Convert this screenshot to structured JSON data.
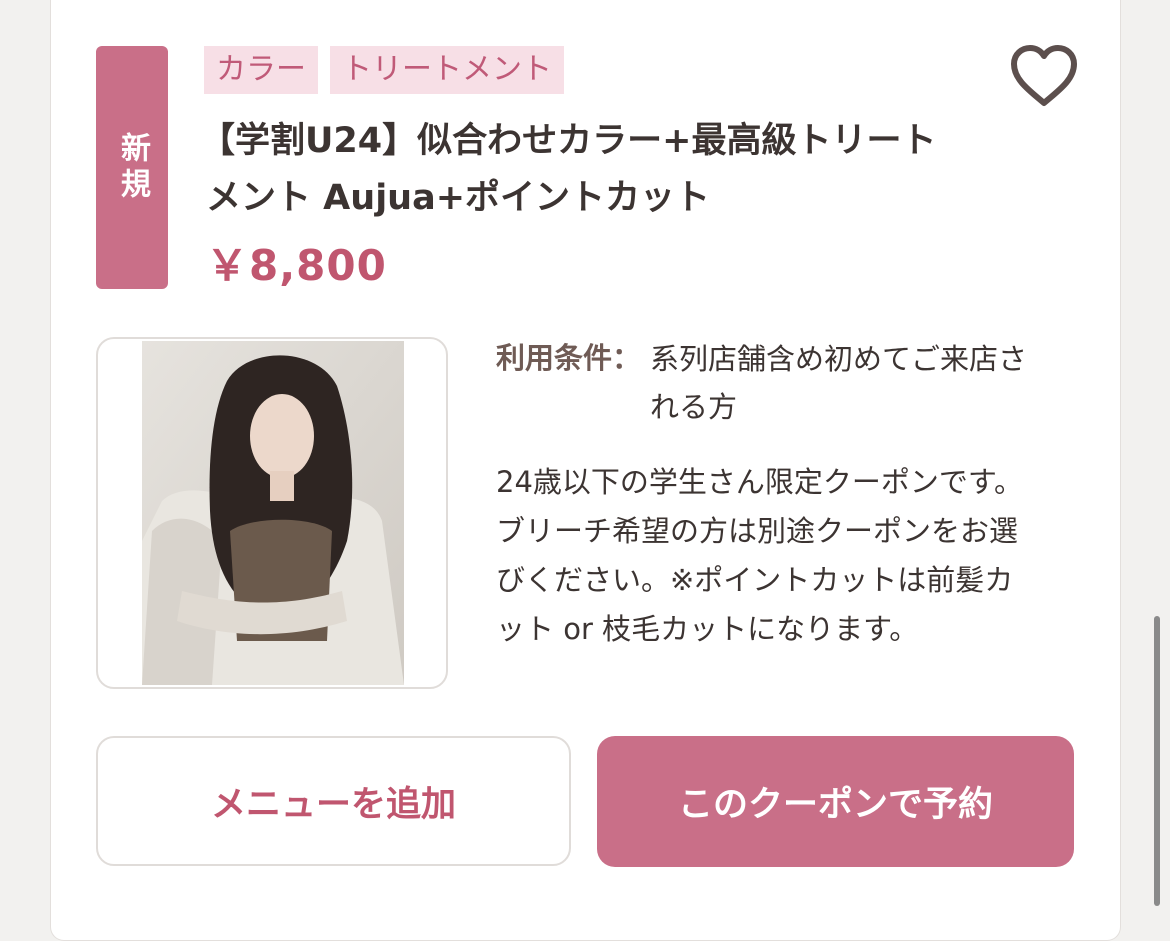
{
  "coupon": {
    "badge": "新規",
    "tags": [
      "カラー",
      "トリートメント"
    ],
    "title_line1": "【学割U24】似合わせカラー+最高級トリート",
    "title_line2": "メント Aujua+ポイントカット",
    "price": "￥8,800",
    "condition_label": "利用条件：",
    "condition_line1": "系列店舗含め初めてご来店さ",
    "condition_line2": "れる方",
    "description_lines": [
      "24歳以下の学生さん限定クーポンです。",
      "ブリーチ希望の方は別途クーポンをお選",
      "びください。※ポイントカットは前髪カ",
      "ット or 枝毛カットになります。"
    ]
  },
  "actions": {
    "add_menu": "メニューを追加",
    "reserve": "このクーポンで予約"
  },
  "colors": {
    "accent": "#c96f88",
    "price": "#c0566f",
    "tag_bg": "#f7dfe6"
  },
  "icons": {
    "favorite": "heart-outline-icon"
  }
}
